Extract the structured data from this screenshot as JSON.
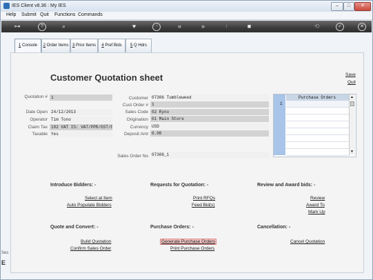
{
  "window": {
    "title": "IES Client v8.36 : My IES"
  },
  "titlebar": {
    "minimize": "–",
    "maximize": "□",
    "close": "✕"
  },
  "menu": [
    "Help",
    "Submit",
    "Quit",
    "Functions",
    "Commands"
  ],
  "toolbar": {
    "icons": [
      "key-icon",
      "help-icon",
      "search-icon",
      "heart-icon",
      "history-icon",
      "rewind-icon",
      "fast-forward-icon",
      "upload-icon",
      "stop-icon",
      "refresh-icon",
      "confirm-icon",
      "close-icon"
    ]
  },
  "tabs": [
    {
      "num": "1",
      "label": "Console"
    },
    {
      "num": "2",
      "label": "Order Items"
    },
    {
      "num": "3",
      "label": "Prior Items"
    },
    {
      "num": "4",
      "label": "Pref Bids"
    },
    {
      "num": "5",
      "label": "Q Hdrs"
    }
  ],
  "sheet": {
    "title": "Customer Quotation sheet",
    "save": "Save",
    "quit": "Quit"
  },
  "left_fields": {
    "quotation_label": "Quotation #",
    "quotation_value": "1",
    "date_open_label": "Date Open",
    "date_open_value": "24/12/2013",
    "operator_label": "Operator",
    "operator_value": "Tim Tono",
    "claim_tax_label": "Claim Tax",
    "claim_tax_value": "102 VAT IS: VAT/PPR/GST/G",
    "taxable_label": "Taxable",
    "taxable_value": "Yes"
  },
  "mid_fields": {
    "customer_label": "Customer",
    "customer_value": "07306 Tumbleweed",
    "cust_order_label": "Cust Order #",
    "cust_order_value": "1",
    "sales_code_label": "Sales Code",
    "sales_code_value": "02 Ryno",
    "origination_label": "Origination",
    "origination_value": "01 Main Store",
    "currency_label": "Currency",
    "currency_value": "USD",
    "deposit_label": "Deposit Amt",
    "deposit_value": "0.00",
    "sales_order_label": "Sales Order No",
    "sales_order_value": "07306_1"
  },
  "purchase_orders": {
    "header": "Purchase Orders",
    "index": "1"
  },
  "sections": {
    "introduce": {
      "title": "Introduce Bidders: -",
      "links": [
        "Select at Item",
        "Auto Populate Bidders"
      ]
    },
    "requests": {
      "title": "Requests for Quotation: -",
      "links": [
        "Print RFQs",
        "Feed Bid(s)"
      ]
    },
    "review": {
      "title": "Review and Award bids: -",
      "links": [
        "Review",
        "Award To",
        "Mark Up"
      ]
    },
    "quote": {
      "title": "Quote and Convert: -",
      "links": [
        "Build Quotation",
        "Confirm Sales Order"
      ]
    },
    "purchase": {
      "title": "Purchase Orders: -",
      "links": [
        "Generate Purchase Orders",
        "Print Purchase Orders"
      ]
    },
    "cancel": {
      "title": "Cancellation: -",
      "links": [
        "Cancel Quotation"
      ]
    }
  },
  "side_text": {
    "a": "Ses",
    "b": "E"
  },
  "colors": {
    "toolbar": "#3c3c3c",
    "po_gutter": "#a9c4e9",
    "highlight_link": "#f5c6c6"
  }
}
